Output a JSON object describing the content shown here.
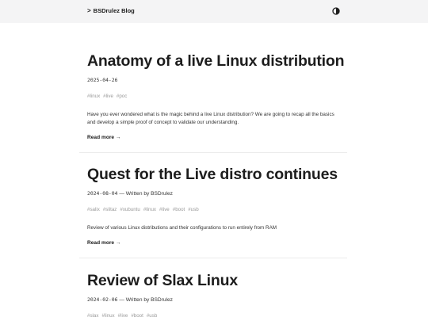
{
  "header": {
    "brand_chevron": ">",
    "brand_label": "BSDrulez Blog",
    "theme_icon": "half-circle-contrast-icon"
  },
  "posts": [
    {
      "title": "Anatomy of a live Linux distribution",
      "date": "2025-04-26",
      "author_text": "",
      "tags": [
        "#linux",
        "#live",
        "#poc"
      ],
      "summary": "Have you ever wondered what is the magic behind a live Linux distribution? We are going to recap all the basics and develop a simple proof of concept to validate our understanding.",
      "read_more": "Read more →"
    },
    {
      "title": "Quest for the Live distro continues",
      "date": "2024-08-04",
      "author_text": " — Written by BSDrulez",
      "tags": [
        "#salix",
        "#slitaz",
        "#xubuntu",
        "#linux",
        "#live",
        "#boot",
        "#usb"
      ],
      "summary": "Review of various Linux distributions and their configurations to run entirely from RAM",
      "read_more": "Read more →"
    },
    {
      "title": "Review of Slax Linux",
      "date": "2024-02-06",
      "author_text": " — Written by BSDrulez",
      "tags": [
        "#slax",
        "#linux",
        "#live",
        "#boot",
        "#usb"
      ]
    }
  ]
}
